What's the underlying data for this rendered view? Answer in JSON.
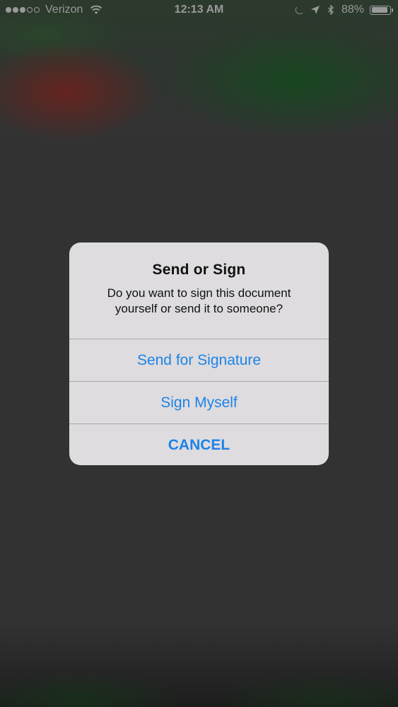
{
  "status_bar": {
    "carrier": "Verizon",
    "time": "12:13 AM",
    "battery_percent": "88%",
    "battery_level": 0.88,
    "signal_bars_filled": 3,
    "signal_bars_total": 5,
    "icons": [
      "wifi-icon",
      "alarm-icon",
      "location-arrow-icon",
      "bluetooth-icon",
      "battery-icon"
    ]
  },
  "alert": {
    "title": "Send or Sign",
    "message": "Do you want to sign this document yourself or send it to someone?",
    "buttons": [
      {
        "label": "Send for Signature"
      },
      {
        "label": "Sign Myself"
      },
      {
        "label": "CANCEL"
      }
    ]
  },
  "colors": {
    "accent": "#1d83e6",
    "alert_background": "#dedcdf",
    "dim_background": "#333233"
  }
}
